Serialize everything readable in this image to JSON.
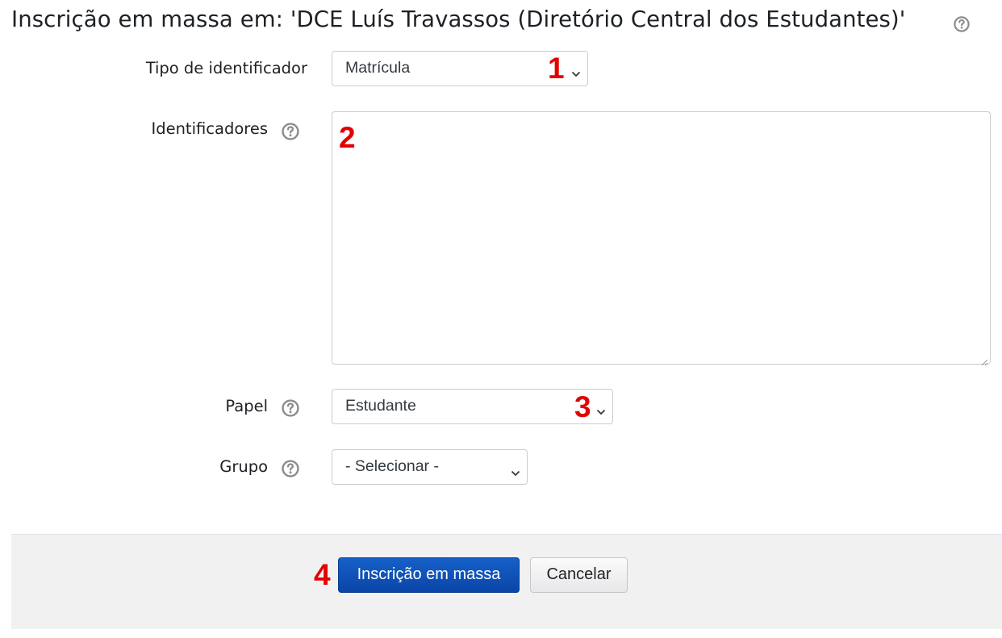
{
  "page": {
    "title": "Inscrição em massa em: 'DCE Luís Travassos (Diretório Central dos Estudantes)'"
  },
  "form": {
    "id_type": {
      "label": "Tipo de identificador",
      "selected": "Matrícula"
    },
    "identifiers": {
      "label": "Identificadores",
      "value": ""
    },
    "role": {
      "label": "Papel",
      "selected": "Estudante"
    },
    "group": {
      "label": "Grupo",
      "selected": "- Selecionar -"
    }
  },
  "buttons": {
    "submit_label": "Inscrição em massa",
    "cancel_label": "Cancelar"
  },
  "markers": [
    "1",
    "2",
    "3",
    "4"
  ],
  "icons": {
    "help": "question-circle-icon",
    "dropdown": "chevron-down-icon",
    "resize": "resize-grip-icon"
  },
  "colors": {
    "primary_button": "#0f51b8",
    "marker": "#e30000",
    "footer_background": "#f1f1f2",
    "help_icon": "#8c8c8c"
  }
}
